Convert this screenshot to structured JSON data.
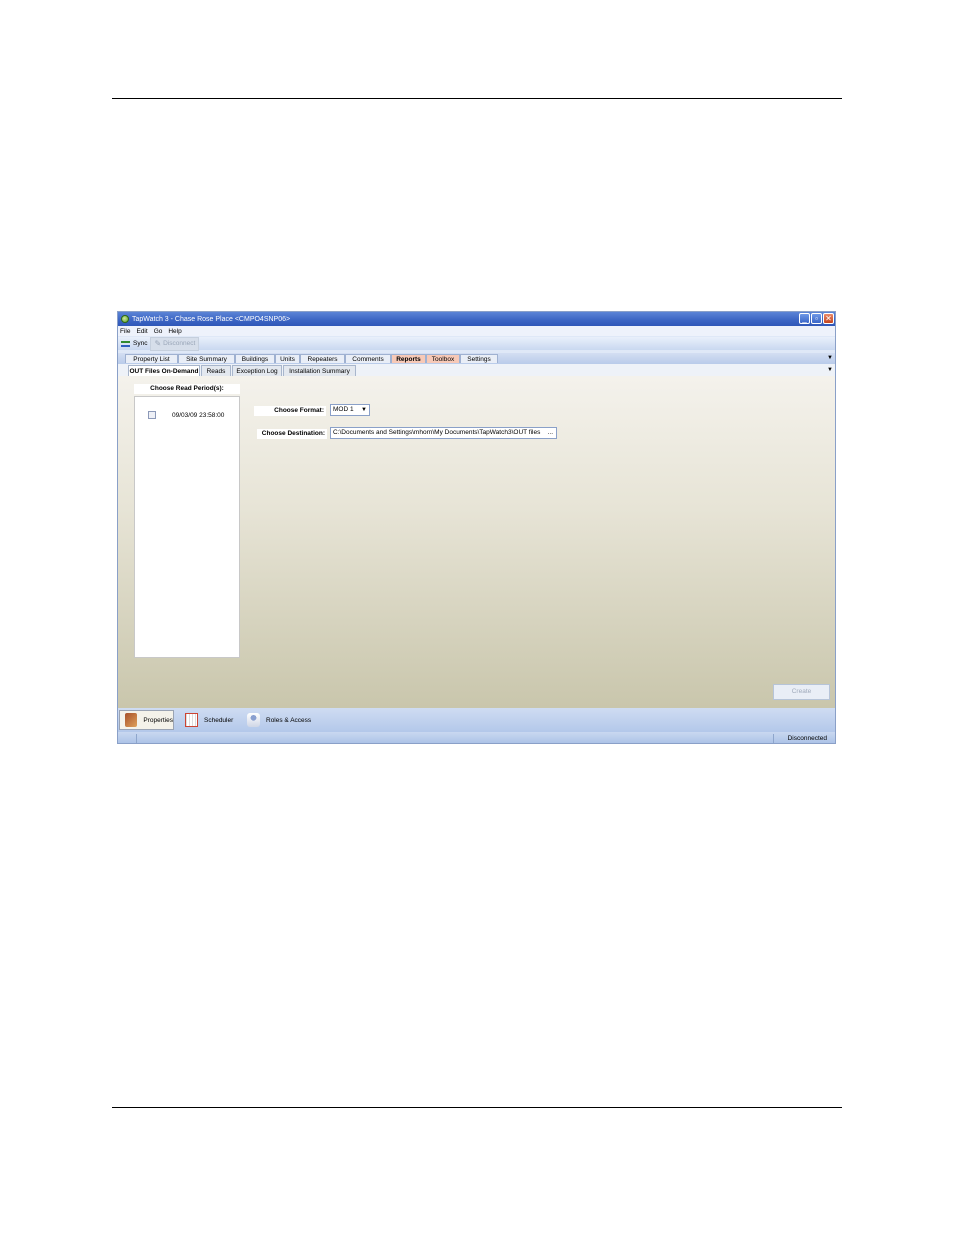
{
  "window": {
    "title": "TapWatch 3 - Chase Rose Place <CMPO4SNP06>",
    "controls": {
      "minimize": "_",
      "restore": "▫",
      "close": "✕"
    }
  },
  "menu": [
    "File",
    "Edit",
    "Go",
    "Help"
  ],
  "toolbar": {
    "sync_label": "Sync",
    "disconnect_label": "Disconnect"
  },
  "tabs_primary": [
    "Property List",
    "Site Summary",
    "Buildings",
    "Units",
    "Repeaters",
    "Comments",
    "Reports",
    "Toolbox",
    "Settings"
  ],
  "tabs_primary_active": "Reports",
  "tabs_secondary": [
    "OUT Files On-Demand",
    "Reads",
    "Exception Log",
    "Installation Summary"
  ],
  "tabs_secondary_active": "OUT Files On-Demand",
  "main": {
    "periods_title": "Choose Read Period(s):",
    "periods": [
      {
        "label": "09/03/09 23:58:00",
        "checked": false
      }
    ],
    "format_label": "Choose Format:",
    "format_value": "MOD 1",
    "destination_label": "Choose Destination:",
    "destination_value": "C:\\Documents and Settings\\mhorn\\My Documents\\TapWatch3\\OUT files",
    "browse_label": "...",
    "create_label": "Create"
  },
  "nav": {
    "properties_label": "Properties",
    "scheduler_label": "Scheduler",
    "roles_label": "Roles & Access"
  },
  "status": {
    "connection": "Disconnected"
  },
  "colors": {
    "title_bar": "#3b64c3",
    "active_tab": "#f7c9b7",
    "content_bottom": "#c9c6ac"
  }
}
